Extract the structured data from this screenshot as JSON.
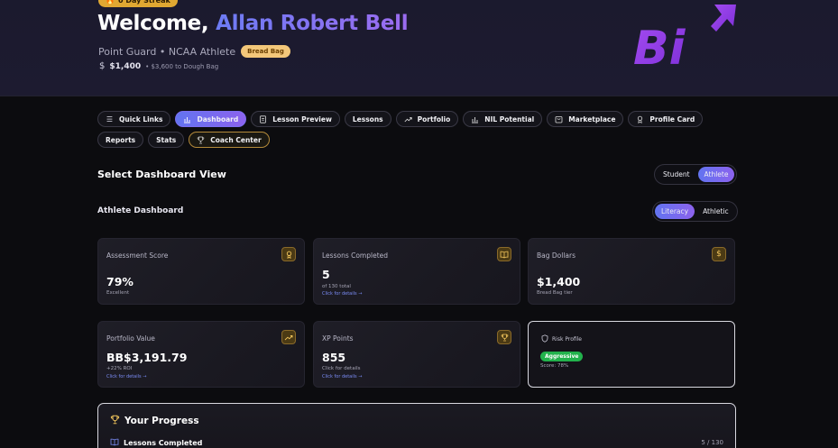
{
  "header": {
    "streak": "0 Day Streak",
    "welcome_prefix": "Welcome,",
    "user_name": "Allan Robert Bell",
    "role_line": "Point Guard • NCAA Athlete",
    "tier_badge": "Bread Bag",
    "dollars": "$1,400",
    "dollars_to_next": "• $3,600 to Dough Bag",
    "logo_text": "Bi"
  },
  "nav": {
    "items": [
      {
        "label": "Quick Links",
        "icon": "menu-icon"
      },
      {
        "label": "Dashboard",
        "icon": "bar-chart-icon",
        "active": true
      },
      {
        "label": "Lesson Preview",
        "icon": "document-icon"
      },
      {
        "label": "Lessons",
        "icon": ""
      },
      {
        "label": "Portfolio",
        "icon": "trend-up-icon"
      },
      {
        "label": "NIL Potential",
        "icon": "bar-chart-icon"
      },
      {
        "label": "Marketplace",
        "icon": "store-icon"
      },
      {
        "label": "Profile Card",
        "icon": "badge-icon"
      },
      {
        "label": "Reports",
        "icon": ""
      },
      {
        "label": "Stats",
        "icon": ""
      },
      {
        "label": "Coach Center",
        "icon": "trophy-icon"
      }
    ]
  },
  "view_select": {
    "title": "Select Dashboard View",
    "options": [
      "Student",
      "Athlete"
    ],
    "selected": "Athlete"
  },
  "dashboard": {
    "title": "Athlete Dashboard",
    "mode_options": [
      "Literacy",
      "Athletic"
    ],
    "mode_selected": "Literacy"
  },
  "cards": [
    {
      "title": "Assessment Score",
      "value": "79%",
      "sub": "Excellent",
      "link": "",
      "icon": "award-icon"
    },
    {
      "title": "Lessons Completed",
      "value": "5",
      "sub": "of 130 total",
      "link": "Click for details →",
      "icon": "book-icon"
    },
    {
      "title": "Bag Dollars",
      "value": "$1,400",
      "sub": "Bread Bag tier",
      "link": "",
      "icon": "dollar-icon"
    },
    {
      "title": "Portfolio Value",
      "value": "BB$3,191.79",
      "sub": "+22% ROI",
      "link": "Click for details →",
      "icon": "trend-up-icon"
    },
    {
      "title": "XP Points",
      "value": "855",
      "sub": "Click for details",
      "link": "Click for details →",
      "icon": "trophy-icon"
    }
  ],
  "risk": {
    "title": "Risk Profile",
    "badge": "Aggressive",
    "score": "Score: 78%"
  },
  "progress": {
    "title": "Your Progress",
    "row_label": "Lessons Completed",
    "row_count": "5 / 130"
  },
  "colors": {
    "accent_start": "#6274f0",
    "accent_end": "#8c62ee",
    "gold": "#e0a832",
    "success": "#22b24c"
  }
}
